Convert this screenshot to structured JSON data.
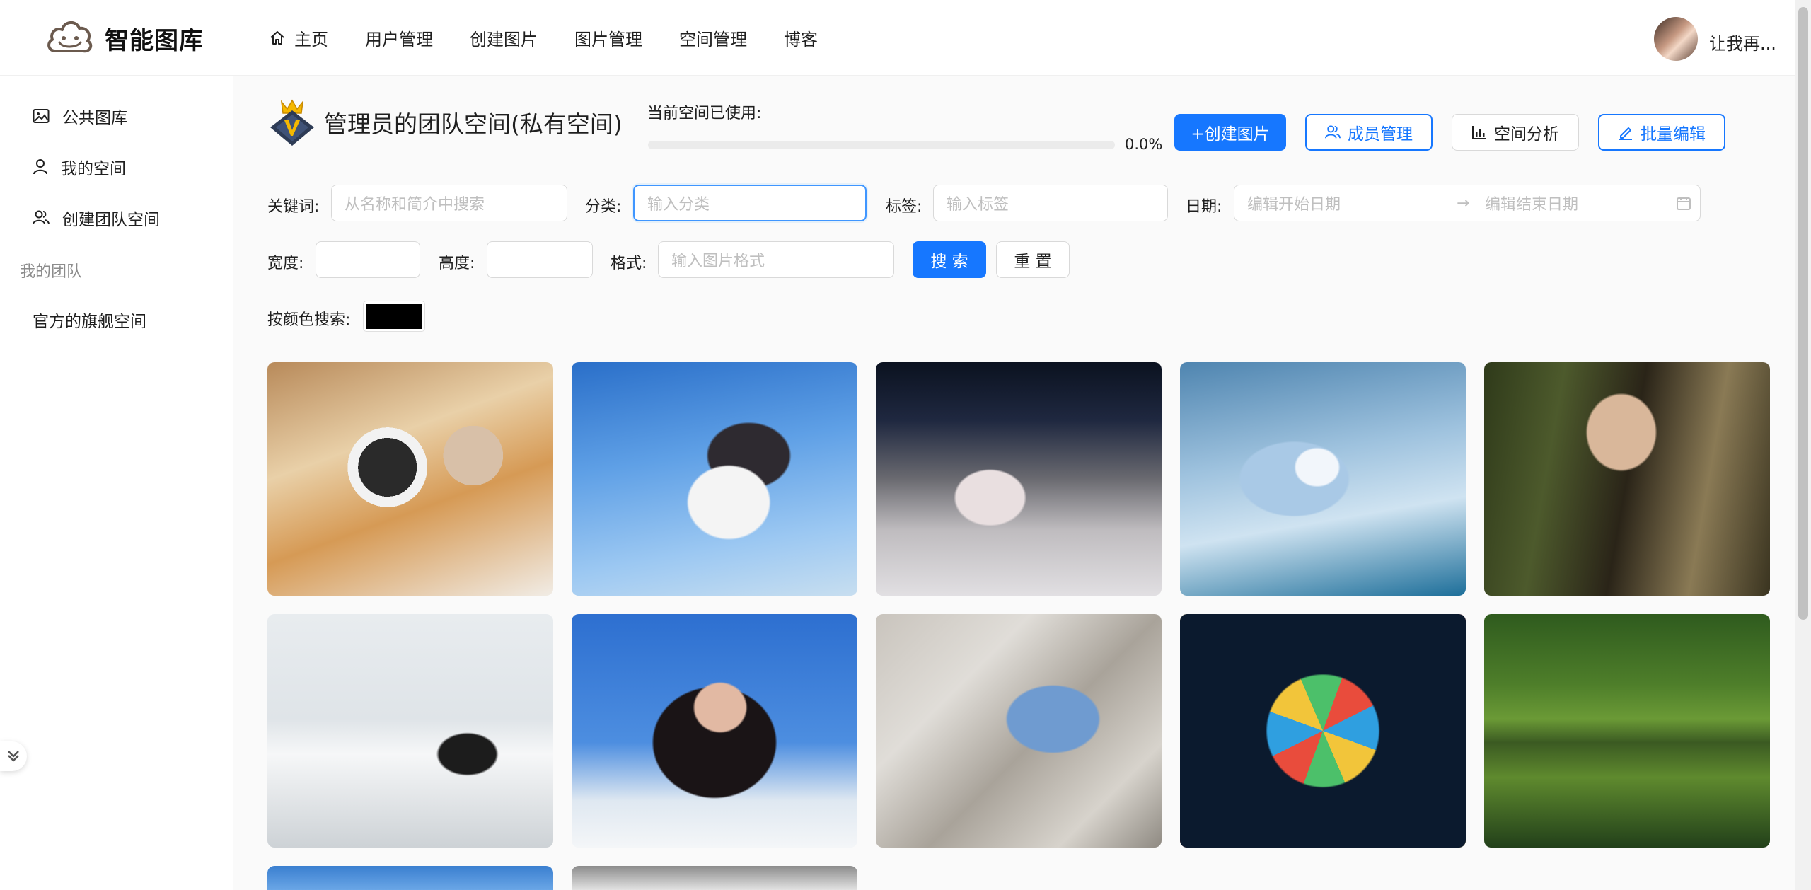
{
  "header": {
    "brand": "智能图库",
    "nav": [
      {
        "label": "主页",
        "icon": "home-icon"
      },
      {
        "label": "用户管理"
      },
      {
        "label": "创建图片"
      },
      {
        "label": "图片管理"
      },
      {
        "label": "空间管理"
      },
      {
        "label": "博客"
      }
    ],
    "username": "让我再..."
  },
  "sidebar": {
    "items": [
      {
        "label": "公共图库",
        "icon": "picture-icon"
      },
      {
        "label": "我的空间",
        "icon": "user-icon"
      },
      {
        "label": "创建团队空间",
        "icon": "team-icon"
      }
    ],
    "group_title": "我的团队",
    "team_items": [
      {
        "label": "官方的旗舰空间"
      }
    ]
  },
  "space": {
    "title": "管理员的团队空间(私有空间)",
    "usage_label": "当前空间已使用:",
    "usage_percent_text": "0.0%",
    "usage_fraction": 0.0
  },
  "actions": {
    "create": "+创建图片",
    "members": "成员管理",
    "analysis": "空间分析",
    "batch_edit": "批量编辑"
  },
  "filters": {
    "keyword_label": "关键词:",
    "keyword_placeholder": "从名称和简介中搜索",
    "category_label": "分类:",
    "category_placeholder": "输入分类",
    "tag_label": "标签:",
    "tag_placeholder": "输入标签",
    "date_label": "日期:",
    "date_start_placeholder": "编辑开始日期",
    "date_end_placeholder": "编辑结束日期",
    "width_label": "宽度:",
    "height_label": "高度:",
    "format_label": "格式:",
    "format_placeholder": "输入图片格式",
    "search_button": "搜 索",
    "reset_button": "重 置",
    "color_label": "按颜色搜索:",
    "color_value": "#000000"
  },
  "colors": {
    "primary": "#1677ff",
    "border": "#d9d9d9",
    "placeholder": "#bfbfbf"
  }
}
